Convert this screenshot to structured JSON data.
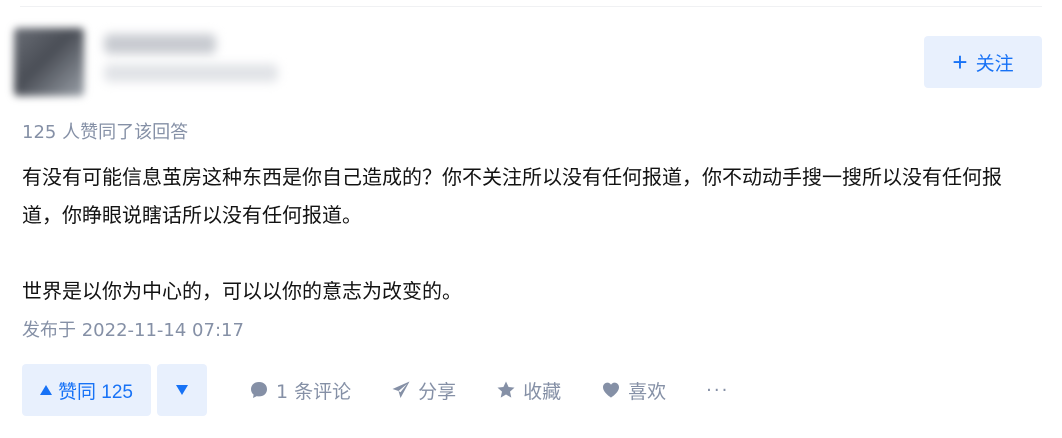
{
  "author": {
    "follow_label": "关注",
    "follow_icon": "plus-icon"
  },
  "answer": {
    "liked_by_text": "125 人赞同了该回答",
    "paragraphs": [
      "有没有可能信息茧房这种东西是你自己造成的？你不关注所以没有任何报道，你不动动手搜一搜所以没有任何报道，你睁眼说瞎话所以没有任何报道。",
      "世界是以你为中心的，可以以你的意志为改变的。"
    ],
    "publish_time": "发布于 2022-11-14 07:17"
  },
  "actions": {
    "vote_up_label": "赞同 125",
    "vote_up_icon": "triangle-up-icon",
    "vote_down_icon": "triangle-down-icon",
    "comment_label": "1 条评论",
    "comment_icon": "comment-bubble-icon",
    "share_label": "分享",
    "share_icon": "paper-plane-icon",
    "favorite_label": "收藏",
    "favorite_icon": "star-icon",
    "like_label": "喜欢",
    "like_icon": "heart-icon",
    "more_label": "···"
  },
  "colors": {
    "accent": "#1772f6",
    "accent_bg": "#e8f0fd",
    "muted_text": "#8590a6",
    "body_text": "#121212"
  }
}
